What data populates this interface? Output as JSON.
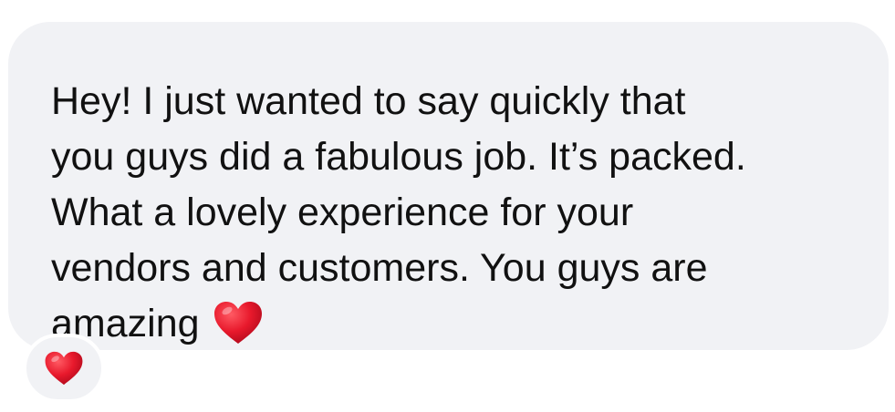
{
  "message": {
    "lines": [
      "Hey! I just wanted to say quickly that",
      "you guys did a fabulous job. It’s packed.",
      "What a lovely experience for your",
      "vendors and customers. You guys are",
      "amazing"
    ],
    "trailing_emoji": "red-heart-icon"
  },
  "reaction": {
    "emoji": "red-heart-icon"
  },
  "colors": {
    "bubble_background": "#f1f2f5",
    "text": "#111111",
    "heart": "#e8192c"
  }
}
